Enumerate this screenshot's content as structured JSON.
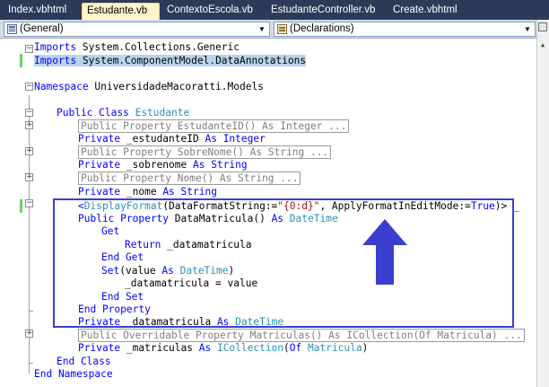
{
  "tabs": [
    {
      "label": "Index.vbhtml",
      "active": false
    },
    {
      "label": "Estudante.vb",
      "active": true
    },
    {
      "label": "ContextoEscola.vb",
      "active": false
    },
    {
      "label": "EstudanteController.vb",
      "active": false
    },
    {
      "label": "Create.vbhtml",
      "active": false
    }
  ],
  "combos": {
    "left": "(General)",
    "right": "(Declarations)"
  },
  "code": {
    "imports1_kw": "Imports",
    "imports1_rest": " System.Collections.Generic",
    "imports2_kw": "Imports",
    "imports2_rest": " System.ComponentModel.DataAnnotations",
    "namespace_kw": "Namespace",
    "namespace_name": " UniversidadeMacoratti.Models",
    "class_kw": "Public Class",
    "class_name": "Estudante",
    "prop_estudanteid": "Public Property EstudanteID() As Integer ...",
    "field1_kw": "Private",
    "field1_name": " _estudanteID ",
    "field1_as": "As",
    "field1_type": "Integer",
    "prop_sobrenome": "Public Property SobreNome() As String ...",
    "field2_kw": "Private",
    "field2_name": " _sobrenome ",
    "field2_as": "As",
    "field2_type": "String",
    "prop_nome": "Public Property Nome() As String ...",
    "field3_kw": "Private",
    "field3_name": " _nome ",
    "field3_as": "As",
    "field3_type": "String",
    "attr_open": "<",
    "attr_name": "DisplayFormat",
    "attr_arg1": "(DataFormatString:=",
    "attr_str": "\"{0:d}\"",
    "attr_arg2": ", ApplyFormatInEditMode:=",
    "attr_true": "True",
    "attr_close": ")> _",
    "prop_dm_kw": "Public Property",
    "prop_dm_name": " DataMatricula() ",
    "prop_dm_as": "As",
    "prop_dm_type": "DateTime",
    "get_kw": "Get",
    "return_kw": "Return",
    "return_val": " _datamatricula",
    "endget_kw": "End Get",
    "set_kw": "Set",
    "set_arg": "(value ",
    "set_as": "As",
    "set_type": "DateTime",
    "set_close": ")",
    "assign": "_datamatricula = value",
    "endset_kw": "End Set",
    "endprop_kw": "End Property",
    "field4_kw": "Private",
    "field4_name": " _datamatricula ",
    "field4_as": "As",
    "field4_type": "DateTime",
    "prop_matriculas": "Public Overridable Property Matriculas() As ICollection(Of Matricula) ...",
    "field5_kw": "Private",
    "field5_name": " _matriculas ",
    "field5_as": "As",
    "field5_type": "ICollection",
    "field5_of_open": "(",
    "field5_of": "Of",
    "field5_of_type": "Matricula",
    "field5_close": ")",
    "endclass_kw": "End Class",
    "endns_kw": "End Namespace"
  },
  "colors": {
    "keyword": "#0000ff",
    "type": "#2b91af",
    "string": "#a31515",
    "annotation": "#3a3fd0"
  }
}
